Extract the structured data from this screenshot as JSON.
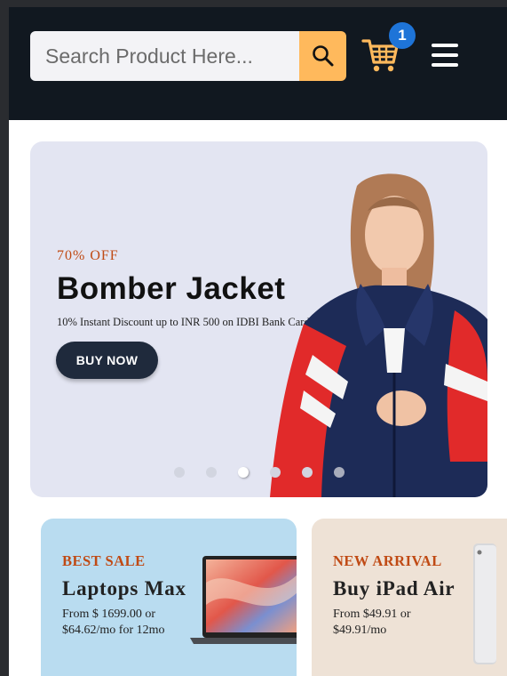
{
  "header": {
    "search_placeholder": "Search Product Here...",
    "cart_count": "1"
  },
  "banner": {
    "tag": "70% OFF",
    "title": "Bomber Jacket",
    "subtitle": "10% Instant Discount up to INR 500 on IDBI Bank Card",
    "button_label": "BUY NOW",
    "slides_total": 6,
    "active_slide": 3
  },
  "promos": [
    {
      "tag": "BEST SALE",
      "title": "Laptops Max",
      "price": "From $ 1699.00 or $64.62/mo for 12mo"
    },
    {
      "tag": "NEW ARRIVAL",
      "title": "Buy iPad Air",
      "price": "From $49.91 or $49.91/mo"
    }
  ],
  "colors": {
    "header_bg": "#111820",
    "accent": "#ffb95c",
    "badge": "#1e74d8",
    "tag_orange": "#c04a14",
    "button_dark": "#1f2a3c",
    "banner_bg": "#e3e5f2",
    "card_blue": "#b9dcf0",
    "card_beige": "#eee2d6"
  },
  "icons": {
    "search": "search-icon",
    "cart": "shopping-cart-icon",
    "menu": "hamburger-menu-icon"
  }
}
